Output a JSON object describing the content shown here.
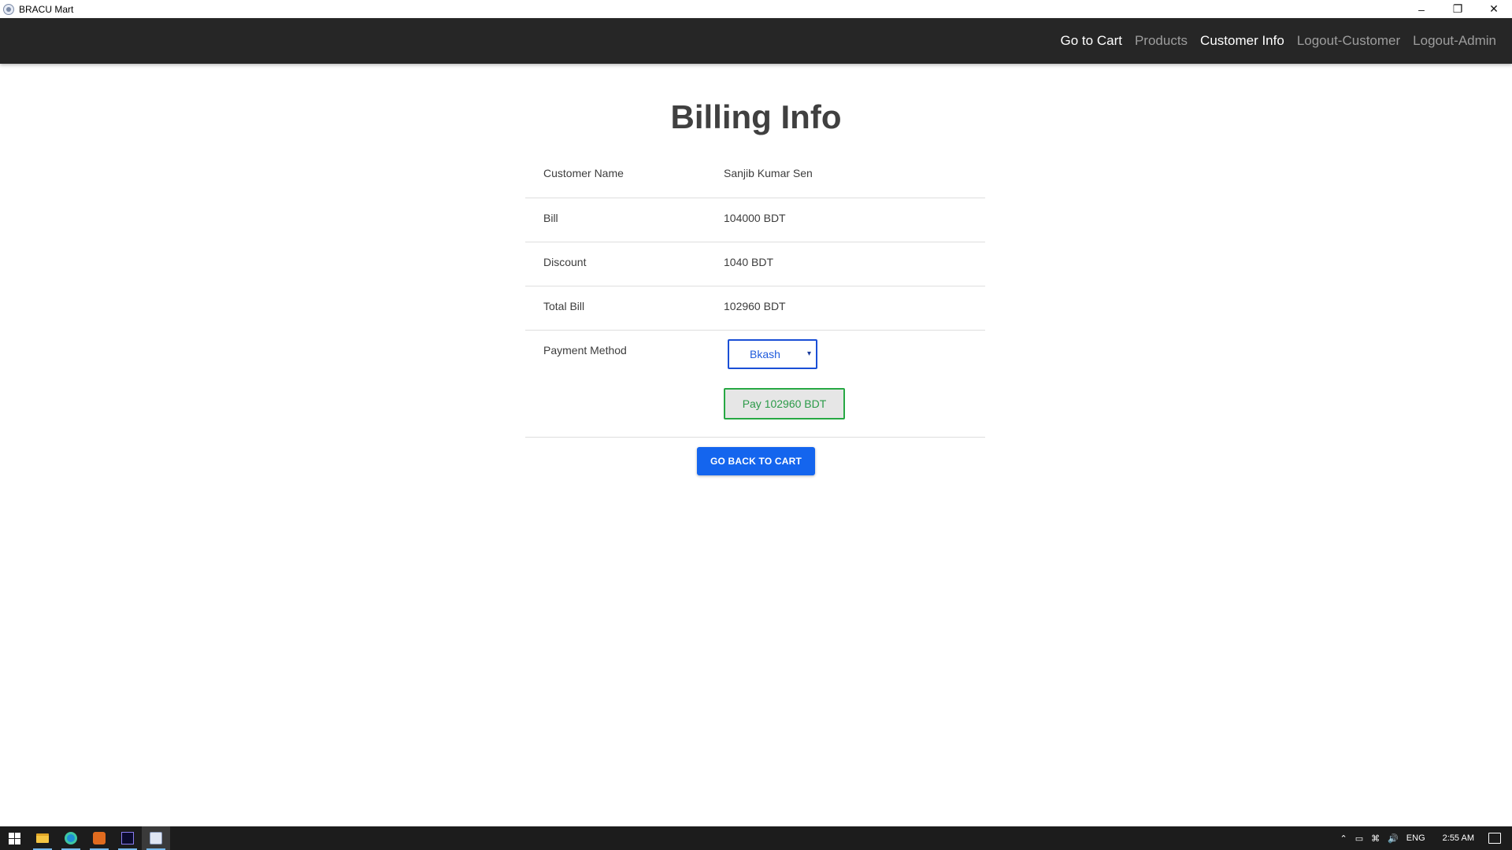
{
  "window": {
    "title": "BRACU Mart",
    "minimize_glyph": "–",
    "restore_glyph": "❐",
    "close_glyph": "✕"
  },
  "navbar": {
    "links": [
      {
        "label": "Go to Cart",
        "active": true
      },
      {
        "label": "Products",
        "active": false
      },
      {
        "label": "Customer Info",
        "active": true
      },
      {
        "label": "Logout-Customer",
        "active": false
      },
      {
        "label": "Logout-Admin",
        "active": false
      }
    ]
  },
  "billing": {
    "title": "Billing Info",
    "rows": [
      {
        "label": "Customer Name",
        "value": "Sanjib Kumar Sen"
      },
      {
        "label": "Bill",
        "value": "104000 BDT"
      },
      {
        "label": "Discount",
        "value": "1040 BDT"
      },
      {
        "label": "Total Bill",
        "value": "102960 BDT"
      }
    ],
    "payment_method": {
      "label": "Payment Method",
      "selected": "Bkash",
      "caret": "▾"
    },
    "pay_button": "Pay 102960 BDT",
    "back_button": "GO BACK TO CART"
  },
  "taskbar": {
    "apps": [
      {
        "icon": "file-explorer-icon"
      },
      {
        "icon": "edge-browser-icon"
      },
      {
        "icon": "xampp-icon"
      },
      {
        "icon": "phpstorm-icon"
      },
      {
        "icon": "bracu-mart-icon",
        "active": true
      }
    ],
    "tray": {
      "chevron": "⌃",
      "language": "ENG",
      "time": "2:55 AM"
    }
  },
  "colors": {
    "navbar_bg": "#262626",
    "nav_active": "#ffffff",
    "nav_inactive": "#9d9d9d",
    "primary_button": "#1465ee",
    "pay_border": "#27a844",
    "select_border": "#1a4fd6"
  }
}
